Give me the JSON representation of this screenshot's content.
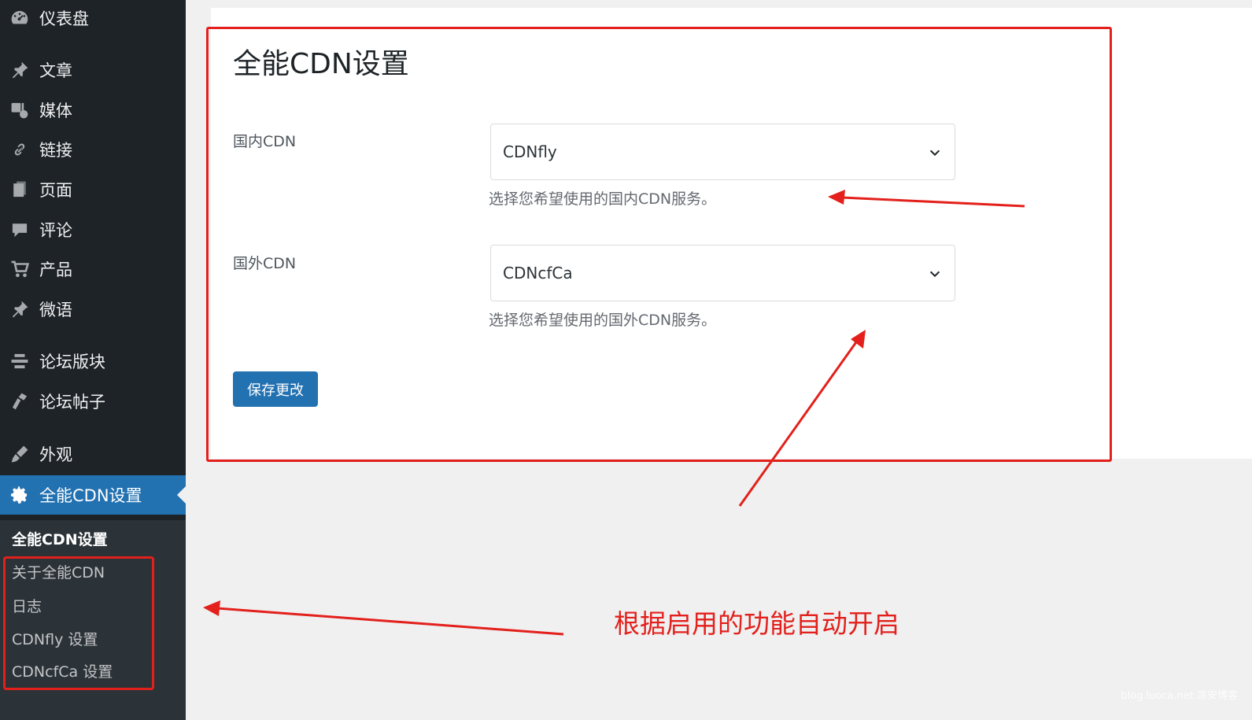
{
  "sidebar": {
    "items": [
      {
        "label": "仪表盘",
        "icon": "dashboard-icon"
      },
      {
        "label": "文章",
        "icon": "pin-icon"
      },
      {
        "label": "媒体",
        "icon": "media-icon"
      },
      {
        "label": "链接",
        "icon": "link-icon"
      },
      {
        "label": "页面",
        "icon": "page-icon"
      },
      {
        "label": "评论",
        "icon": "comment-icon"
      },
      {
        "label": "产品",
        "icon": "cart-icon"
      },
      {
        "label": "微语",
        "icon": "pin-icon"
      },
      {
        "label": "论坛版块",
        "icon": "forum-icon"
      },
      {
        "label": "论坛帖子",
        "icon": "topic-icon"
      },
      {
        "label": "外观",
        "icon": "brush-icon"
      },
      {
        "label": "全能CDN设置",
        "icon": "gear-icon"
      }
    ],
    "submenu": [
      {
        "label": "全能CDN设置"
      },
      {
        "label": "关于全能CDN"
      },
      {
        "label": "日志"
      },
      {
        "label": "CDNfly 设置"
      },
      {
        "label": "CDNcfCa 设置"
      }
    ]
  },
  "main": {
    "title": "全能CDN设置",
    "fields": [
      {
        "label": "国内CDN",
        "value": "CDNfly",
        "description": "选择您希望使用的国内CDN服务。"
      },
      {
        "label": "国外CDN",
        "value": "CDNcfCa",
        "description": "选择您希望使用的国外CDN服务。"
      }
    ],
    "save_label": "保存更改"
  },
  "annotation": "根据启用的功能自动开启",
  "watermark": "blog.luoca.net 凉安博客",
  "colors": {
    "sidebar": "#1d2327",
    "accent": "#2271b1",
    "annotation": "#e3201b",
    "background": "#f0f0f1"
  }
}
